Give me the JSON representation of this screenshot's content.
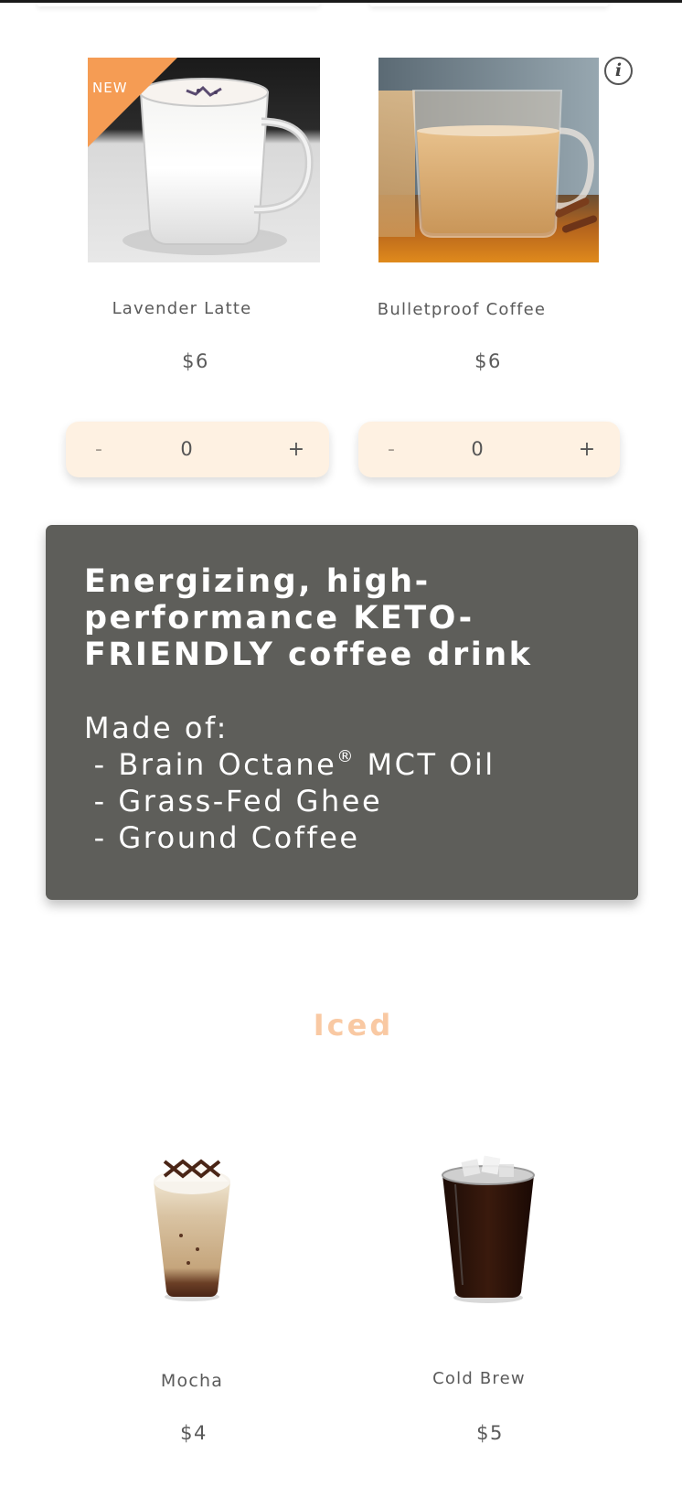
{
  "row1": {
    "items": [
      {
        "name": "Lavender Latte",
        "price": "$6",
        "badge": "NEW",
        "quantity": "0",
        "decrement_label": "-",
        "increment_label": "+"
      },
      {
        "name": "Bulletproof Coffee",
        "price": "$6",
        "quantity": "0",
        "decrement_label": "-",
        "increment_label": "+"
      }
    ]
  },
  "info_panel": {
    "headline": "Energizing, high-performance KETO-FRIENDLY coffee drink",
    "made_of_label": "Made of:",
    "ingredients": [
      " - Brain Octane",
      " - Grass-Fed Ghee",
      " - Ground Coffee"
    ],
    "ingredient_suffix": " MCT Oil",
    "registered_mark": "®"
  },
  "section": {
    "title": "Iced"
  },
  "row2": {
    "items": [
      {
        "name": "Mocha",
        "price": "$4"
      },
      {
        "name": "Cold Brew",
        "price": "$5"
      }
    ]
  },
  "colors": {
    "accent": "#f59c54",
    "section_title": "#f9c9a3",
    "stepper_bg": "#fef1e2",
    "panel_bg": "#5e5e5a"
  }
}
